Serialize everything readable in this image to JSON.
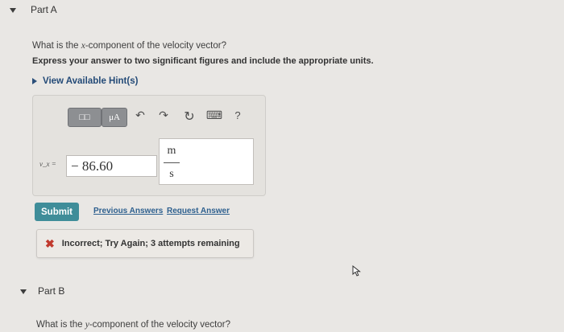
{
  "part_a": {
    "label": "Part A"
  },
  "question": {
    "prefix": "What is the ",
    "variable": "x",
    "suffix": "-component of the velocity vector?",
    "instruction": "Express your answer to two significant figures and include the appropriate units."
  },
  "hint": {
    "label": "View Available Hint(s)"
  },
  "toolbar": {
    "template_label": "□□",
    "units_label": "μA",
    "undo_icon": "↶",
    "redo_icon": "↷",
    "reset_icon": "↻",
    "keyboard_icon": "⌨",
    "help_label": "?"
  },
  "answer": {
    "var_label": "v_x =",
    "value": "− 86.60",
    "unit_num": "m",
    "unit_den": "s"
  },
  "actions": {
    "submit": "Submit",
    "previous": "Previous Answers",
    "request": "Request Answer"
  },
  "feedback": {
    "icon": "✖",
    "text": "Incorrect; Try Again; 3 attempts remaining"
  },
  "part_b": {
    "label": "Part B",
    "prefix": "What is the ",
    "variable": "y",
    "suffix": "-component of the velocity vector?"
  }
}
